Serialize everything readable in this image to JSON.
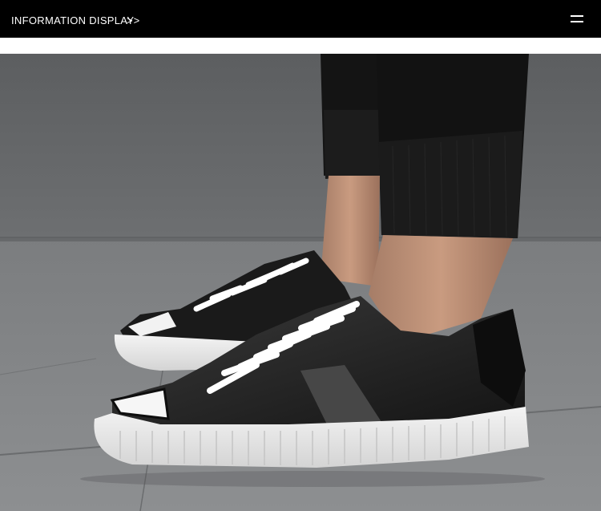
{
  "header": {
    "title": "INFORMATION DISPLAY",
    "arrow": ">>",
    "menu_icon": "hamburger-menu-icon"
  },
  "colors": {
    "header_bg": "#000000",
    "header_text": "#ffffff",
    "page_bg": "#ffffff"
  },
  "photo": {
    "alt": "Black low-top sneakers with white laces and white rubber soles"
  }
}
